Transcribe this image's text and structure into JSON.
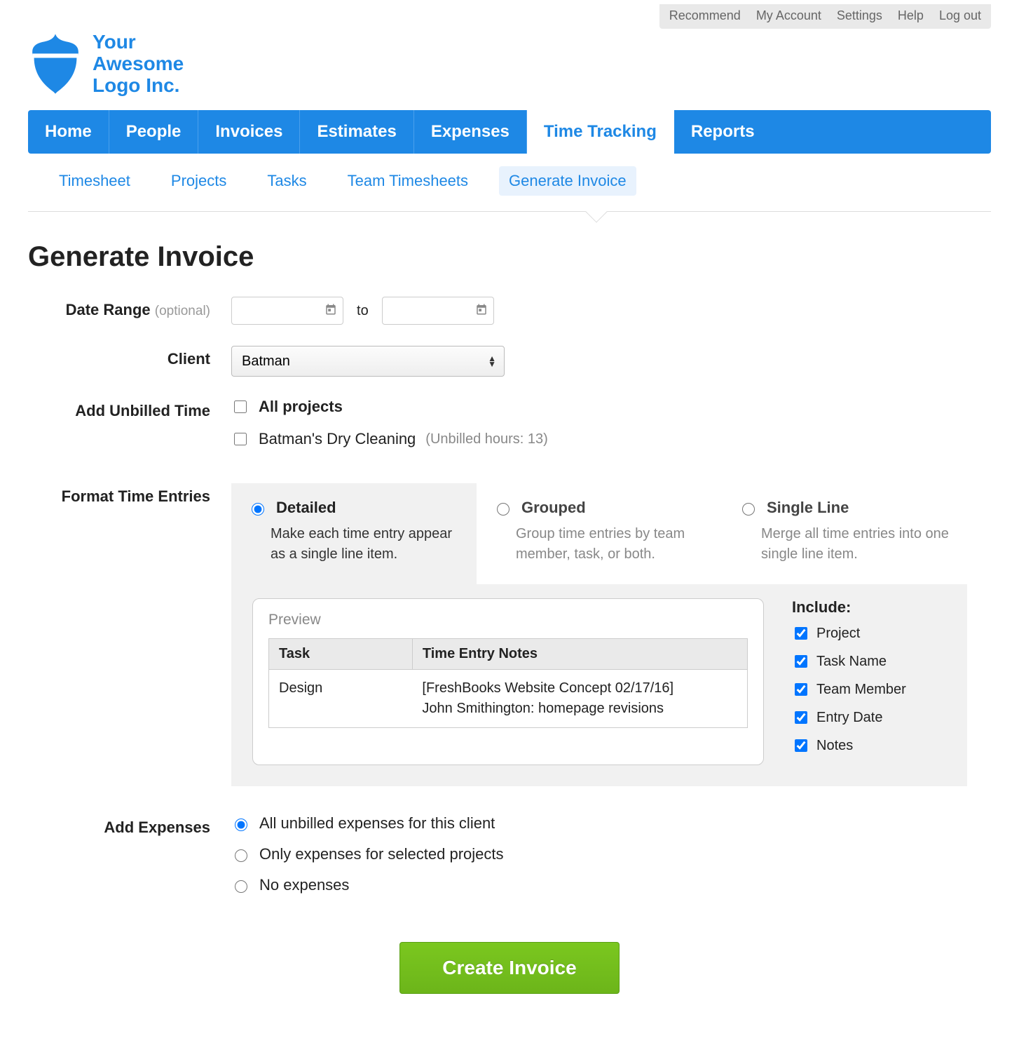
{
  "util_nav": [
    "Recommend",
    "My Account",
    "Settings",
    "Help",
    "Log out"
  ],
  "logo": {
    "line1": "Your",
    "line2": "Awesome",
    "line3": "Logo Inc."
  },
  "primary_tabs": {
    "items": [
      "Home",
      "People",
      "Invoices",
      "Estimates",
      "Expenses",
      "Time Tracking",
      "Reports"
    ],
    "active_index": 5
  },
  "secondary_tabs": {
    "items": [
      "Timesheet",
      "Projects",
      "Tasks",
      "Team Timesheets",
      "Generate Invoice"
    ],
    "active_index": 4
  },
  "page_title": "Generate Invoice",
  "date_range": {
    "label": "Date Range",
    "optional": "(optional)",
    "to": "to",
    "from_value": "",
    "to_value": ""
  },
  "client": {
    "label": "Client",
    "selected": "Batman"
  },
  "add_unbilled": {
    "label": "Add Unbilled Time",
    "all_label": "All projects",
    "all_checked": false,
    "projects": [
      {
        "name": "Batman's Dry Cleaning",
        "note": "(Unbilled hours: 13)",
        "checked": false
      }
    ]
  },
  "format": {
    "label": "Format Time Entries",
    "options": [
      {
        "id": "detailed",
        "title": "Detailed",
        "desc": "Make each time entry appear as a single line item."
      },
      {
        "id": "grouped",
        "title": "Grouped",
        "desc": "Group time entries by team member, task, or both."
      },
      {
        "id": "single",
        "title": "Single Line",
        "desc": "Merge all time entries into one single line item."
      }
    ],
    "selected": "detailed",
    "preview": {
      "title": "Preview",
      "headers": [
        "Task",
        "Time Entry Notes"
      ],
      "row": {
        "task": "Design",
        "notes_line1": "[FreshBooks Website Concept 02/17/16]",
        "notes_line2": "John Smithington: homepage revisions"
      }
    },
    "include": {
      "title": "Include:",
      "items": [
        {
          "label": "Project",
          "checked": true
        },
        {
          "label": "Task Name",
          "checked": true
        },
        {
          "label": "Team Member",
          "checked": true
        },
        {
          "label": "Entry Date",
          "checked": true
        },
        {
          "label": "Notes",
          "checked": true
        }
      ]
    }
  },
  "expenses": {
    "label": "Add Expenses",
    "options": [
      "All unbilled expenses for this client",
      "Only expenses for selected projects",
      "No expenses"
    ],
    "selected_index": 0
  },
  "create_button": "Create Invoice"
}
